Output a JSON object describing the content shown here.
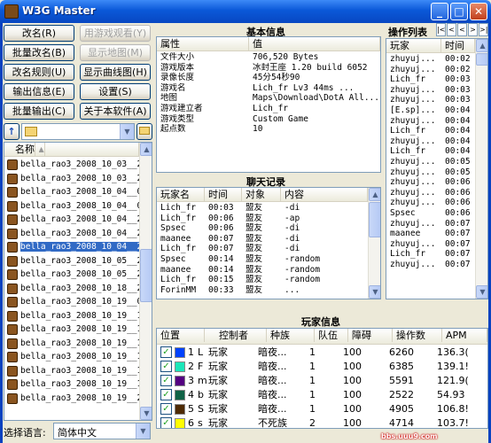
{
  "window": {
    "title": "W3G Master",
    "min": "_",
    "max": "□",
    "close": "✕"
  },
  "buttons": {
    "rename": "改名(R)",
    "batch_rename": "批量改名(B)",
    "rename_rule": "改名规则(U)",
    "export_info": "输出信息(E)",
    "batch_export": "批量输出(C)",
    "watch_replay": "用游戏观看(Y)",
    "show_map": "显示地图(M)",
    "show_curve": "显示曲线图(H)",
    "settings": "设置(S)",
    "about": "关于本软件(A)"
  },
  "files": {
    "header": "名称",
    "items": [
      "bella_rao3_2008_10_03__22...",
      "bella_rao3_2008_10_03__23...",
      "bella_rao3_2008_10_04__00...",
      "bella_rao3_2008_10_04__01...",
      "bella_rao3_2008_10_04__20...",
      "bella_rao3_2008_10_04__21...",
      "bella_rao3_2008_10_04__22...",
      "bella_rao3_2008_10_05__22...",
      "bella_rao3_2008_10_05__22...",
      "bella_rao3_2008_10_18__23...",
      "bella_rao3_2008_10_19__01...",
      "bella_rao3_2008_10_19__15...",
      "bella_rao3_2008_10_19__15...",
      "bella_rao3_2008_10_19__17...",
      "bella_rao3_2008_10_19__17...",
      "bella_rao3_2008_10_19__18...",
      "bella_rao3_2008_10_19__19...",
      "bella_rao3_2008_10_19__20..."
    ],
    "selected": 6
  },
  "language": {
    "label": "选择语言:",
    "value": "简体中文"
  },
  "basic": {
    "title": "基本信息",
    "col_attr": "属性",
    "col_value": "值",
    "rows": [
      [
        "文件大小",
        "706,520 Bytes"
      ],
      [
        "游戏版本",
        "冰封王座 1.20 build 6052"
      ],
      [
        "录像长度",
        "45分54秒90"
      ],
      [
        "游戏名",
        "Lich_fr Lv3 44ms             ..."
      ],
      [
        "地图",
        "Maps\\Download\\DotA All..."
      ],
      [
        "游戏建立者",
        "Lich_fr"
      ],
      [
        "游戏类型",
        "Custom Game"
      ],
      [
        "起点数",
        "10"
      ]
    ]
  },
  "chat": {
    "title": "聊天记录",
    "cols": [
      "玩家名",
      "时间",
      "对象",
      "内容"
    ],
    "rows": [
      [
        "Lich_fr",
        "00:03",
        "盟友",
        "-di"
      ],
      [
        "Lich_fr",
        "00:06",
        "盟友",
        "-ap"
      ],
      [
        "Spsec",
        "00:06",
        "盟友",
        "-di"
      ],
      [
        "maanee",
        "00:07",
        "盟友",
        "-di"
      ],
      [
        "Lich_fr",
        "00:07",
        "盟友",
        "-di"
      ],
      [
        "Spsec",
        "00:14",
        "盟友",
        "-random"
      ],
      [
        "maanee",
        "00:14",
        "盟友",
        "-random"
      ],
      [
        "Lich_fr",
        "00:15",
        "盟友",
        "-random"
      ],
      [
        "ForinMM",
        "00:33",
        "盟友",
        "..."
      ]
    ]
  },
  "ops": {
    "title": "操作列表",
    "nav": [
      "|<",
      "<",
      "<",
      ">",
      ">|"
    ],
    "cols": [
      "玩家",
      "时间"
    ],
    "rows": [
      [
        "zhuyuj...",
        "00:02"
      ],
      [
        "zhuyuj...",
        "00:02"
      ],
      [
        "Lich_fr",
        "00:03"
      ],
      [
        "zhuyuj...",
        "00:03"
      ],
      [
        "zhuyuj...",
        "00:03"
      ],
      [
        "[E.sp]...",
        "00:04"
      ],
      [
        "zhuyuj...",
        "00:04"
      ],
      [
        "Lich_fr",
        "00:04"
      ],
      [
        "zhuyuj...",
        "00:04"
      ],
      [
        "Lich_fr",
        "00:04"
      ],
      [
        "zhuyuj...",
        "00:05"
      ],
      [
        "zhuyuj...",
        "00:05"
      ],
      [
        "zhuyuj...",
        "00:06"
      ],
      [
        "zhuyuj...",
        "00:06"
      ],
      [
        "zhuyuj...",
        "00:06"
      ],
      [
        "Spsec",
        "00:06"
      ],
      [
        "zhuyuj...",
        "00:07"
      ],
      [
        "maanee",
        "00:07"
      ],
      [
        "zhuyuj...",
        "00:07"
      ],
      [
        "Lich_fr",
        "00:07"
      ],
      [
        "zhuyuj...",
        "00:07"
      ]
    ]
  },
  "players": {
    "title": "玩家信息",
    "cols": [
      "位置",
      "控制者",
      "种族",
      "队伍",
      "障碍",
      "操作数",
      "APM"
    ],
    "rows": [
      {
        "color": "#0042ff",
        "pos": "1",
        "slot": "L",
        "ctrl": "玩家",
        "race": "暗夜...",
        "team": "1",
        "hcap": "100",
        "ops": "6260",
        "apm": "136.3("
      },
      {
        "color": "#1ce6b9",
        "pos": "2",
        "slot": "F",
        "ctrl": "玩家",
        "race": "暗夜...",
        "team": "1",
        "hcap": "100",
        "ops": "6385",
        "apm": "139.1!"
      },
      {
        "color": "#540081",
        "pos": "3",
        "slot": "m",
        "ctrl": "玩家",
        "race": "暗夜...",
        "team": "1",
        "hcap": "100",
        "ops": "5591",
        "apm": "121.9("
      },
      {
        "color": "#106246",
        "pos": "4",
        "slot": "b",
        "ctrl": "玩家",
        "race": "暗夜...",
        "team": "1",
        "hcap": "100",
        "ops": "2522",
        "apm": "54.93"
      },
      {
        "color": "#4e2a04",
        "pos": "5",
        "slot": "S",
        "ctrl": "玩家",
        "race": "暗夜...",
        "team": "1",
        "hcap": "100",
        "ops": "4905",
        "apm": "106.8!"
      },
      {
        "color": "#fffc01",
        "pos": "6",
        "slot": "s",
        "ctrl": "玩家",
        "race": "不死族",
        "team": "2",
        "hcap": "100",
        "ops": "4714",
        "apm": "103.7!"
      }
    ]
  },
  "watermark": "bbs.uuu9.com"
}
